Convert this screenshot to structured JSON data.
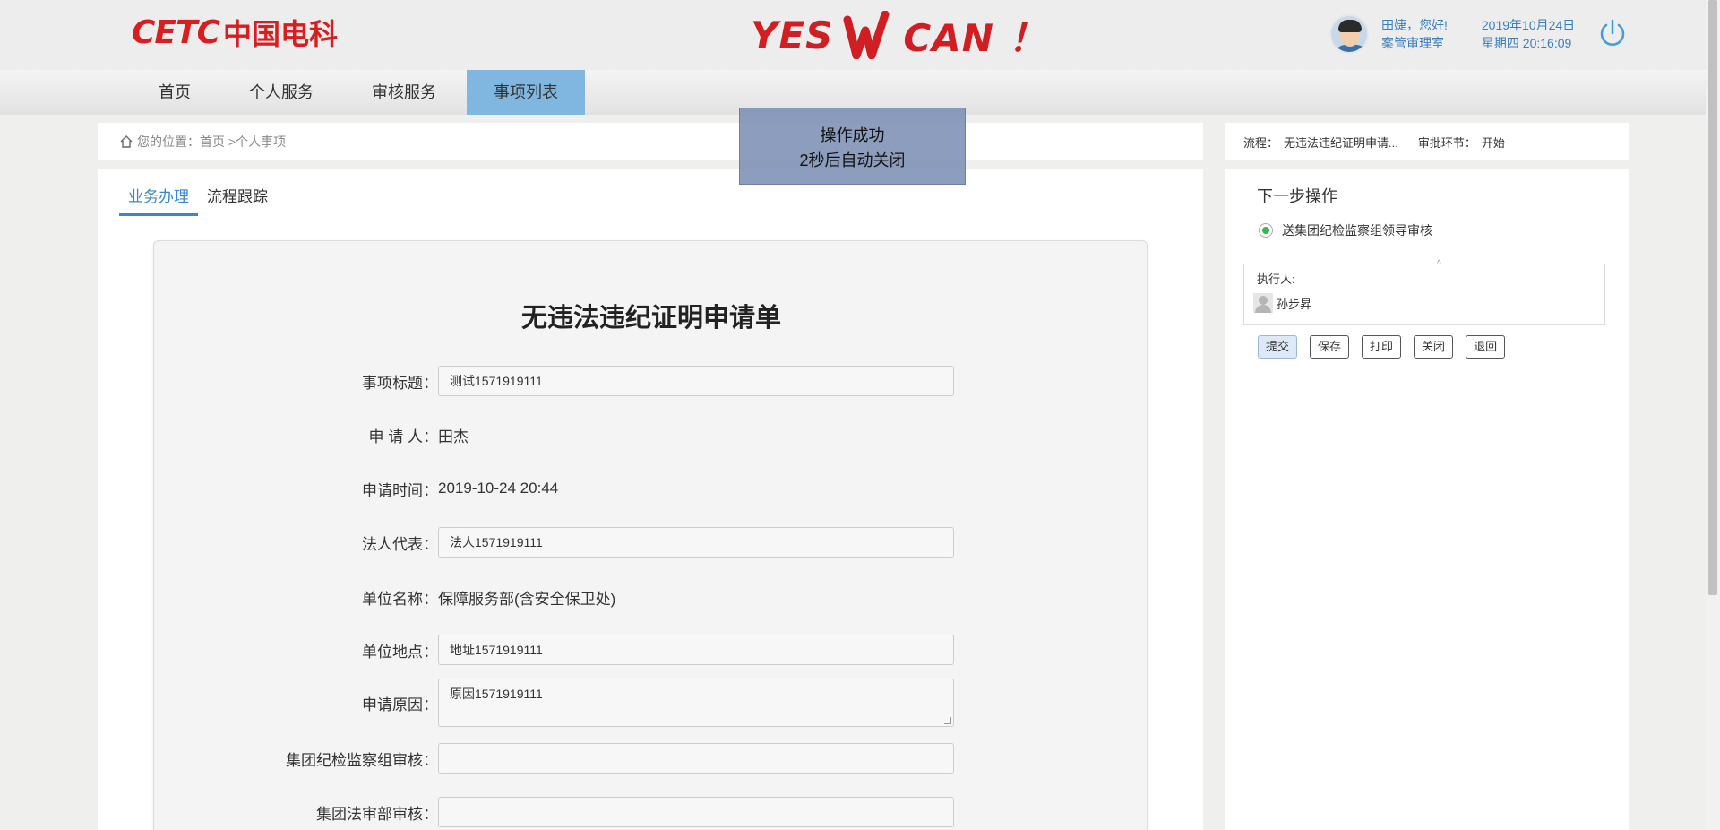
{
  "header": {
    "logo_latin": "CETC",
    "logo_cn": "中国电科",
    "slogan_left": "YES",
    "slogan_right": "CAN ！",
    "greeting": "田婕，您好!",
    "department": "案管审理室",
    "date": "2019年10月24日",
    "weekday_time": "星期四 20:16:09"
  },
  "nav": {
    "items": [
      {
        "label": "首页"
      },
      {
        "label": "个人服务"
      },
      {
        "label": "审核服务"
      },
      {
        "label": "事项列表",
        "active": true
      }
    ]
  },
  "breadcrumb": {
    "text": "您的位置：首页 >个人事项"
  },
  "process": {
    "flow_label": "流程：",
    "flow_value": "无违法违纪证明申请...",
    "step_label": "审批环节：",
    "step_value": "开始"
  },
  "tabs": [
    {
      "label": "业务办理",
      "active": true
    },
    {
      "label": "流程跟踪"
    }
  ],
  "form": {
    "title": "无违法违纪证明申请单",
    "fields": {
      "subject": {
        "label": "事项标题：",
        "value": "测试1571919111"
      },
      "applicant": {
        "label": "申 请 人：",
        "value": "田杰"
      },
      "apply_time": {
        "label": "申请时间：",
        "value": "2019-10-24 20:44"
      },
      "legal_rep": {
        "label": "法人代表：",
        "value": "法人1571919111"
      },
      "unit_name": {
        "label": "单位名称：",
        "value": "保障服务部(含安全保卫处)"
      },
      "unit_location": {
        "label": "单位地点：",
        "value": "地址1571919111"
      },
      "reason": {
        "label": "申请原因：",
        "value": "原因1571919111"
      },
      "group_discipline": {
        "label": "集团纪检监察组审核：",
        "value": ""
      },
      "group_legal": {
        "label": "集团法审部审核：",
        "value": ""
      }
    }
  },
  "side": {
    "title": "下一步操作",
    "option": "送集团纪检监察组领导审核",
    "executor_label": "执行人:",
    "executor_name": "孙步昇",
    "buttons": {
      "submit": "提交",
      "save": "保存",
      "print": "打印",
      "close": "关闭",
      "return": "退回"
    }
  },
  "toast": {
    "line1": "操作成功",
    "line2": "2秒后自动关闭"
  },
  "colors": {
    "brand_red": "#d81e1e",
    "accent_blue": "#3a86c8",
    "nav_active": "#7fb7e0",
    "radio_green": "#2ebb4f"
  }
}
